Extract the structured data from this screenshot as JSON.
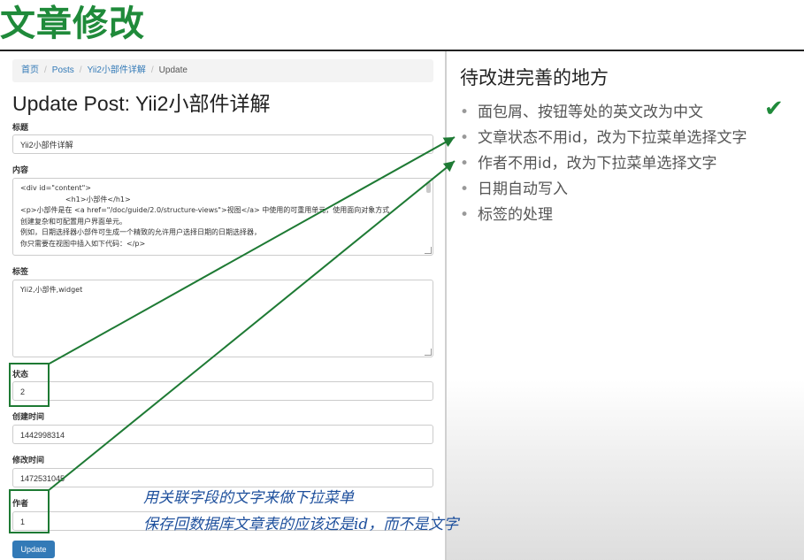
{
  "slide": {
    "title": "文章修改"
  },
  "breadcrumb": [
    {
      "label": "首页",
      "link": true
    },
    {
      "label": "Posts",
      "link": true
    },
    {
      "label": "Yii2小部件详解",
      "link": true
    },
    {
      "label": "Update",
      "link": false
    }
  ],
  "form": {
    "heading": "Update Post: Yii2小部件详解",
    "title_label": "标题",
    "title_value": "Yii2小部件详解",
    "content_label": "内容",
    "content_lines": [
      "<div id=\"content\">",
      "                    <h1>小部件</h1>",
      "<p>小部件是在 <a href=\"/doc/guide/2.0/structure-views\">视图</a> 中使用的可重用单元，使用面向对象方式",
      "创建复杂和可配置用户界面单元。",
      "例如，日期选择器小部件可生成一个精致的允许用户选择日期的日期选择器，",
      "你只需要在视图中插入如下代码：</p>"
    ],
    "tags_label": "标签",
    "tags_value": "Yii2,小部件,widget",
    "status_label": "状态",
    "status_value": "2",
    "create_time_label": "创建时间",
    "create_time_value": "1442998314",
    "update_time_label": "修改时间",
    "update_time_value": "1472531045",
    "author_label": "作者",
    "author_value": "1",
    "submit_label": "Update"
  },
  "notes": {
    "heading": "待改进完善的地方",
    "items": [
      "面包屑、按钮等处的英文改为中文",
      "文章状态不用id，改为下拉菜单选择文字",
      "作者不用id，改为下拉菜单选择文字",
      "日期自动写入",
      "标签的处理"
    ],
    "check_mark": "✔"
  },
  "annotation": {
    "line1": "用关联字段的文字来做下拉菜单",
    "line2": "保存回数据库文章表的应该还是id，而不是文字"
  },
  "colors": {
    "accent_green": "#1f8a3a",
    "link_blue": "#337ab7",
    "annotation_blue": "#1d4f9c"
  }
}
